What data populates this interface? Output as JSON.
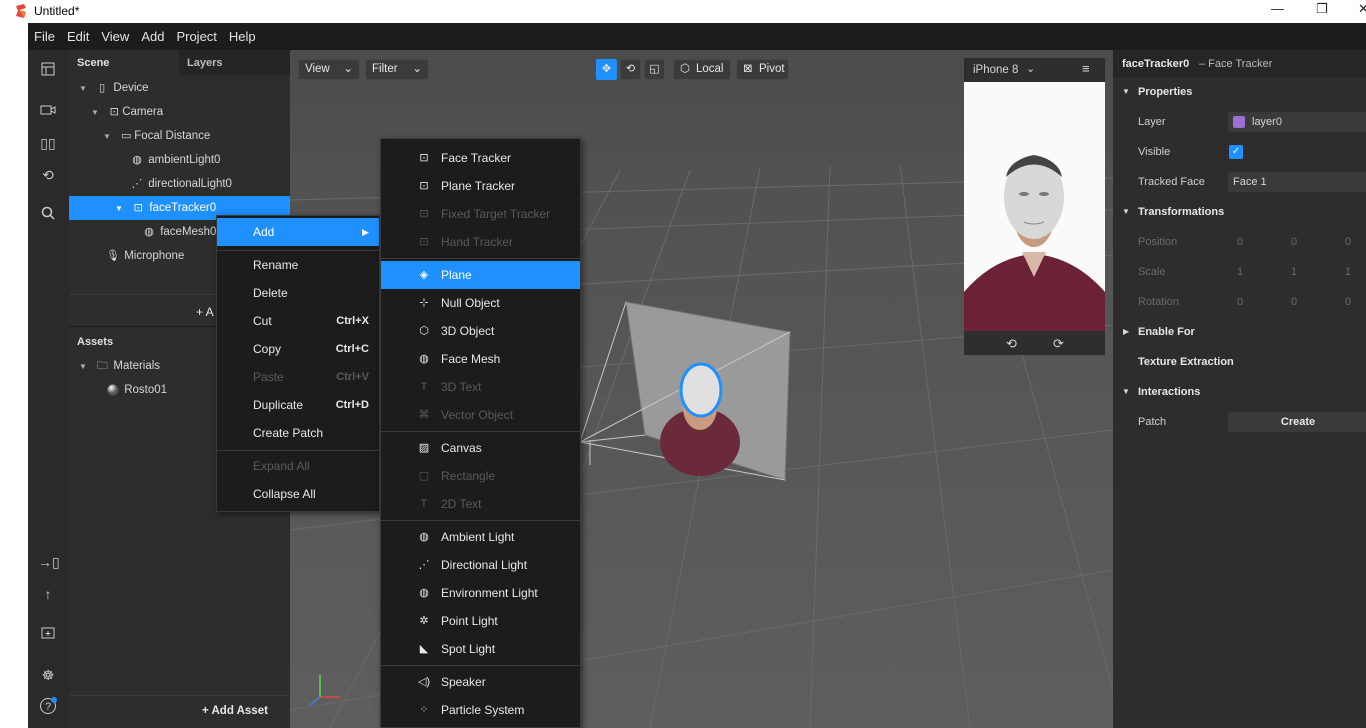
{
  "window": {
    "title": "Untitled*"
  },
  "menubar": [
    "File",
    "Edit",
    "View",
    "Add",
    "Project",
    "Help"
  ],
  "scene_panel": {
    "tab_scene": "Scene",
    "tab_layers": "Layers",
    "tree": [
      {
        "label": "Device",
        "icon": "device-icon"
      },
      {
        "label": "Camera",
        "icon": "camera-icon"
      },
      {
        "label": "Focal Distance",
        "icon": "focal-distance-icon"
      },
      {
        "label": "ambientLight0",
        "icon": "ambient-light-icon"
      },
      {
        "label": "directionalLight0",
        "icon": "directional-light-icon"
      },
      {
        "label": "faceTracker0",
        "icon": "face-tracker-icon"
      },
      {
        "label": "faceMesh0",
        "icon": "face-mesh-icon"
      },
      {
        "label": "Microphone",
        "icon": "microphone-icon"
      }
    ],
    "add_object": "+ A",
    "assets_title": "Assets",
    "assets": [
      {
        "label": "Materials",
        "icon": "folder-icon"
      },
      {
        "label": "Rosto01",
        "icon": "material-sphere-icon"
      }
    ],
    "add_asset": "+ Add Asset"
  },
  "viewport": {
    "view_label": "View",
    "filter_label": "Filter",
    "local_label": "Local",
    "pivot_label": "Pivot"
  },
  "preview": {
    "device": "iPhone 8"
  },
  "context_menu": {
    "items": [
      {
        "label": "Add",
        "shortcut": ""
      },
      {
        "label": "Rename",
        "shortcut": ""
      },
      {
        "label": "Delete",
        "shortcut": ""
      },
      {
        "label": "Cut",
        "shortcut": "Ctrl+X"
      },
      {
        "label": "Copy",
        "shortcut": "Ctrl+C"
      },
      {
        "label": "Paste",
        "shortcut": "Ctrl+V"
      },
      {
        "label": "Duplicate",
        "shortcut": "Ctrl+D"
      },
      {
        "label": "Create Patch",
        "shortcut": ""
      },
      {
        "label": "Expand All",
        "shortcut": ""
      },
      {
        "label": "Collapse All",
        "shortcut": ""
      }
    ]
  },
  "add_submenu": {
    "items": [
      {
        "label": "Face Tracker",
        "icon": "face-tracker-icon"
      },
      {
        "label": "Plane Tracker",
        "icon": "plane-tracker-icon"
      },
      {
        "label": "Fixed Target Tracker",
        "icon": "target-tracker-icon"
      },
      {
        "label": "Hand Tracker",
        "icon": "hand-tracker-icon"
      },
      {
        "label": "Plane",
        "icon": "plane-icon"
      },
      {
        "label": "Null Object",
        "icon": "null-object-icon"
      },
      {
        "label": "3D Object",
        "icon": "cube-icon"
      },
      {
        "label": "Face Mesh",
        "icon": "face-mesh-icon"
      },
      {
        "label": "3D Text",
        "icon": "text-icon"
      },
      {
        "label": "Vector Object",
        "icon": "vector-icon"
      },
      {
        "label": "Canvas",
        "icon": "canvas-icon"
      },
      {
        "label": "Rectangle",
        "icon": "rectangle-icon"
      },
      {
        "label": "2D Text",
        "icon": "text-icon"
      },
      {
        "label": "Ambient Light",
        "icon": "ambient-light-icon"
      },
      {
        "label": "Directional Light",
        "icon": "directional-light-icon"
      },
      {
        "label": "Environment Light",
        "icon": "environment-light-icon"
      },
      {
        "label": "Point Light",
        "icon": "point-light-icon"
      },
      {
        "label": "Spot Light",
        "icon": "spot-light-icon"
      },
      {
        "label": "Speaker",
        "icon": "speaker-icon"
      },
      {
        "label": "Particle System",
        "icon": "particle-icon"
      }
    ]
  },
  "properties": {
    "object_name": "faceTracker0",
    "object_type": "– Face Tracker",
    "properties_title": "Properties",
    "layer_label": "Layer",
    "layer_value": "layer0",
    "visible_label": "Visible",
    "tracked_face_label": "Tracked Face",
    "tracked_face_value": "Face 1",
    "transformations_title": "Transformations",
    "position_label": "Position",
    "scale_label": "Scale",
    "rotation_label": "Rotation",
    "position_vals": [
      "0",
      "0",
      "0"
    ],
    "scale_vals": [
      "1",
      "1",
      "1"
    ],
    "rotation_vals": [
      "0",
      "0",
      "0"
    ],
    "enable_for_title": "Enable For",
    "texture_extraction_title": "Texture Extraction",
    "interactions_title": "Interactions",
    "patch_label": "Patch",
    "create_label": "Create"
  },
  "colors": {
    "accent": "#1e90ff",
    "panel": "#2d2d2d",
    "viewport": "#5a5a5a",
    "layer_swatch": "#9b6fd6"
  }
}
